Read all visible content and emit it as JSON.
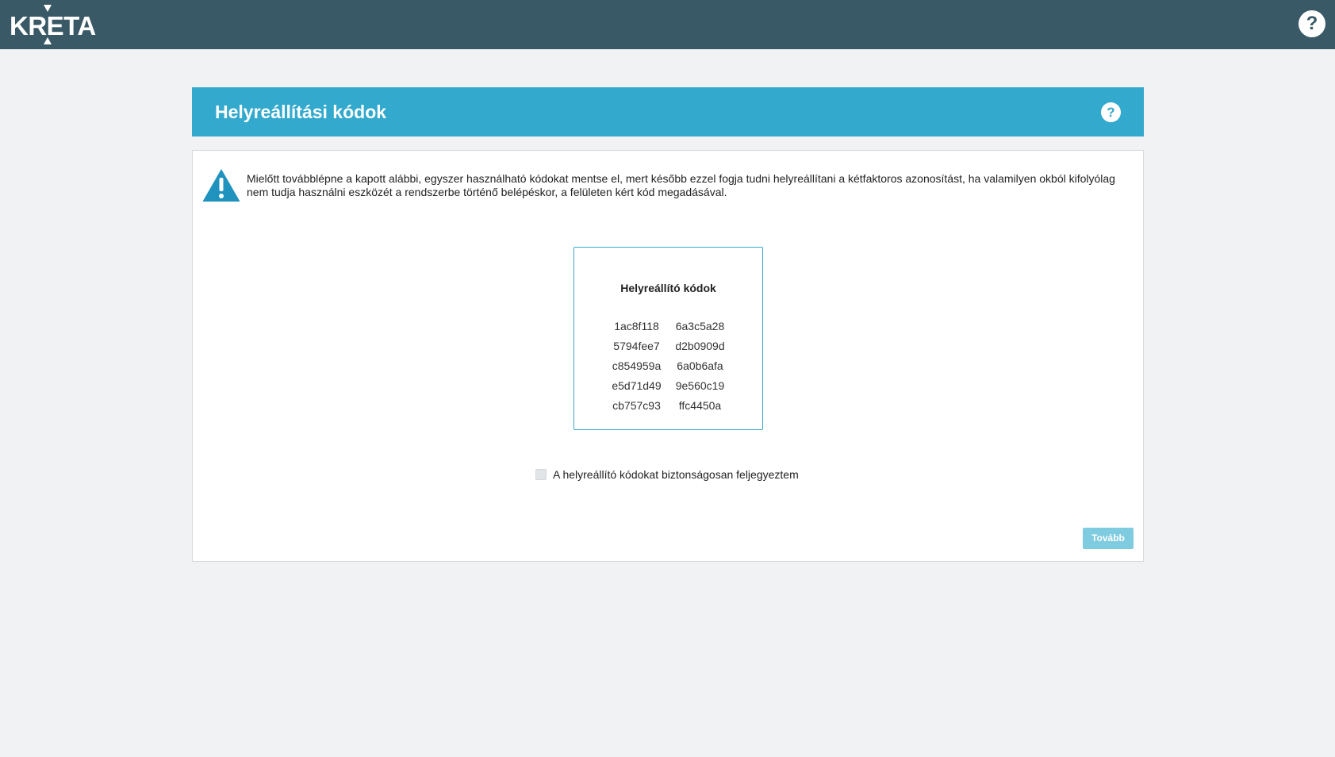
{
  "topbar": {
    "logo_text": "KRETA",
    "help_label": "?",
    "background": "#395966"
  },
  "header": {
    "title": "Helyreállítási kódok",
    "help_label": "?",
    "background": "#33a9cd"
  },
  "warning": {
    "icon": "warning-triangle-icon",
    "text": "Mielőtt továbblépne a kapott alábbi, egyszer használható kódokat mentse el, mert később ezzel fogja tudni helyreállítani a kétfaktoros azonosítást, ha valamilyen okból kifolyólag nem tudja használni eszközét a rendszerbe történő belépéskor, a felületen kért kód megadásával."
  },
  "codes": {
    "title": "Helyreállító kódok",
    "rows": [
      [
        "1ac8f118",
        "6a3c5a28"
      ],
      [
        "5794fee7",
        "d2b0909d"
      ],
      [
        "c854959a",
        "6a0b6afa"
      ],
      [
        "e5d71d49",
        "9e560c19"
      ],
      [
        "cb757c93",
        "ffc4450a"
      ]
    ]
  },
  "confirm": {
    "label": "A helyreállító kódokat biztonságosan feljegyeztem",
    "checked": false
  },
  "next_button": {
    "label": "Tovább",
    "background": "#7fcbe0"
  }
}
